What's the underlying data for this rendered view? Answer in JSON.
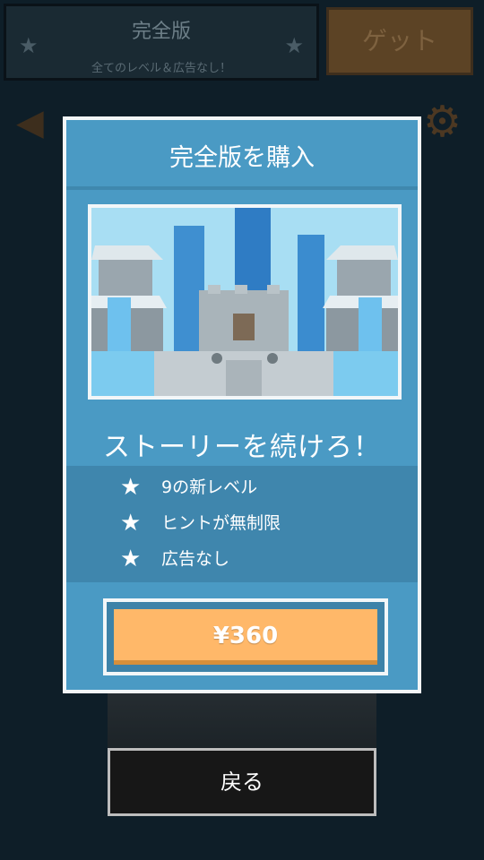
{
  "background": {
    "banner_title": "完全版",
    "banner_subtitle": "全てのレベル＆広告なし！",
    "get_button_label": "ゲット"
  },
  "modal": {
    "title": "完全版を購入",
    "subtitle": "ストーリーを続けろ！",
    "features": [
      {
        "icon": "star-icon",
        "label": "9の新レベル"
      },
      {
        "icon": "star-icon",
        "label": "ヒントが無制限"
      },
      {
        "icon": "star-icon",
        "label": "広告なし"
      }
    ],
    "price_button_label": "¥360"
  },
  "back_button_label": "戻る",
  "colors": {
    "modal_bg": "#4a9ac4",
    "buy_button": "#ffb869",
    "border": "#f2f6f8"
  }
}
